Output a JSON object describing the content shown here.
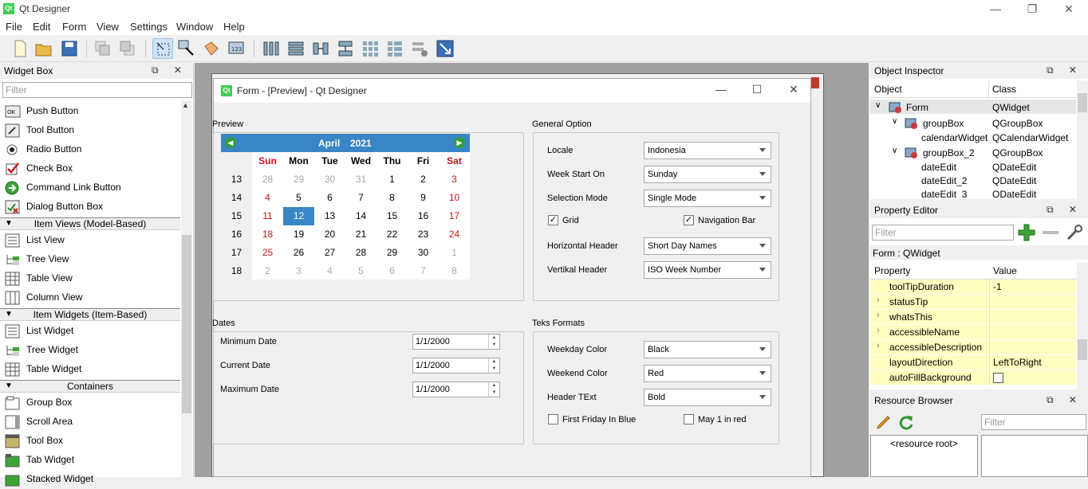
{
  "app": {
    "title": "Qt Designer",
    "icon": "Qt"
  },
  "menu": [
    "File",
    "Edit",
    "Form",
    "View",
    "Settings",
    "Window",
    "Help"
  ],
  "widget_box": {
    "title": "Widget Box",
    "filter_placeholder": "Filter",
    "items": [
      {
        "label": "Push Button",
        "icon": "push-button-icon"
      },
      {
        "label": "Tool Button",
        "icon": "tool-button-icon"
      },
      {
        "label": "Radio Button",
        "icon": "radio-button-icon"
      },
      {
        "label": "Check Box",
        "icon": "check-box-icon"
      },
      {
        "label": "Command Link Button",
        "icon": "command-link-icon"
      },
      {
        "label": "Dialog Button Box",
        "icon": "dialog-button-box-icon"
      }
    ],
    "cat_item_views": "Item Views (Model-Based)",
    "item_views": [
      "List View",
      "Tree View",
      "Table View",
      "Column View"
    ],
    "cat_item_widgets": "Item Widgets (Item-Based)",
    "item_widgets": [
      "List Widget",
      "Tree Widget",
      "Table Widget"
    ],
    "cat_containers": "Containers",
    "containers": [
      "Group Box",
      "Scroll Area",
      "Tool Box",
      "Tab Widget",
      "Stacked Widget"
    ]
  },
  "preview": {
    "title": "Form - [Preview] - Qt Designer",
    "group_preview": "Preview",
    "group_general": "General Option",
    "group_dates": "Dates",
    "group_teks": "Teks Formats",
    "calendar": {
      "month": "April",
      "year": "2021",
      "days": [
        "Sun",
        "Mon",
        "Tue",
        "Wed",
        "Thu",
        "Fri",
        "Sat"
      ],
      "weeks": [
        "13",
        "14",
        "15",
        "16",
        "17",
        "18"
      ],
      "rows": [
        [
          "28",
          "29",
          "30",
          "31",
          "1",
          "2",
          "3"
        ],
        [
          "4",
          "5",
          "6",
          "7",
          "8",
          "9",
          "10"
        ],
        [
          "11",
          "12",
          "13",
          "14",
          "15",
          "16",
          "17"
        ],
        [
          "18",
          "19",
          "20",
          "21",
          "22",
          "23",
          "24"
        ],
        [
          "25",
          "26",
          "27",
          "28",
          "29",
          "30",
          "1"
        ],
        [
          "2",
          "3",
          "4",
          "5",
          "6",
          "7",
          "8"
        ]
      ],
      "selected": "12"
    },
    "general": {
      "locale_label": "Locale",
      "locale_value": "Indonesia",
      "week_start_label": "Week Start On",
      "week_start_value": "Sunday",
      "selection_label": "Selection Mode",
      "selection_value": "Single Mode",
      "grid_label": "Grid",
      "grid_checked": true,
      "nav_label": "Navigation Bar",
      "nav_checked": true,
      "hheader_label": "Horizontal Header",
      "hheader_value": "Short Day Names",
      "vheader_label": "Vertikal Header",
      "vheader_value": "ISO Week Number"
    },
    "dates": {
      "min_label": "Minimum Date",
      "min_value": "1/1/2000",
      "cur_label": "Current Date",
      "cur_value": "1/1/2000",
      "max_label": "Maximum Date",
      "max_value": "1/1/2000"
    },
    "teks": {
      "weekday_label": "Weekday Color",
      "weekday_value": "Black",
      "weekend_label": "Weekend Color",
      "weekend_value": "Red",
      "header_label": "Header TExt",
      "header_value": "Bold",
      "first_friday_label": "First Friday In Blue",
      "may1_label": "May 1 in red"
    }
  },
  "object_inspector": {
    "title": "Object Inspector",
    "col_object": "Object",
    "col_class": "Class",
    "rows": [
      {
        "obj": "Form",
        "cls": "QWidget"
      },
      {
        "obj": "groupBox",
        "cls": "QGroupBox"
      },
      {
        "obj": "calendarWidget",
        "cls": "QCalendarWidget"
      },
      {
        "obj": "groupBox_2",
        "cls": "QGroupBox"
      },
      {
        "obj": "dateEdit",
        "cls": "QDateEdit"
      },
      {
        "obj": "dateEdit_2",
        "cls": "QDateEdit"
      },
      {
        "obj": "dateEdit_3",
        "cls": "QDateEdit"
      }
    ]
  },
  "property_editor": {
    "title": "Property Editor",
    "filter_placeholder": "Filter",
    "context": "Form : QWidget",
    "col_property": "Property",
    "col_value": "Value",
    "rows": [
      {
        "name": "toolTipDuration",
        "value": "-1"
      },
      {
        "name": "statusTip",
        "value": ""
      },
      {
        "name": "whatsThis",
        "value": ""
      },
      {
        "name": "accessibleName",
        "value": ""
      },
      {
        "name": "accessibleDescription",
        "value": ""
      },
      {
        "name": "layoutDirection",
        "value": "LeftToRight"
      },
      {
        "name": "autoFillBackground",
        "value": ""
      }
    ]
  },
  "resource_browser": {
    "title": "Resource Browser",
    "filter_placeholder": "Filter",
    "root": "<resource root>"
  }
}
